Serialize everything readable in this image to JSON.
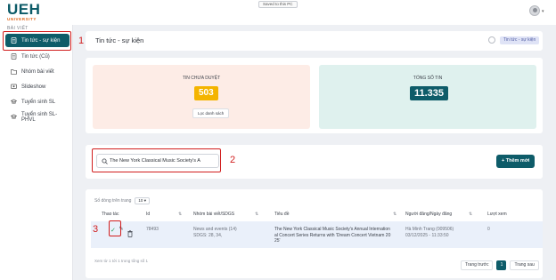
{
  "header": {
    "logo_main": "UEH",
    "logo_sub": "UNIVERSITY",
    "saved_label": "Saved to this PC"
  },
  "sidebar": {
    "section": "BÀI VIẾT",
    "items": [
      {
        "label": "Tin tức - sự kiện",
        "icon": "document-icon",
        "active": true
      },
      {
        "label": "Tin tức (Cũ)",
        "icon": "document-icon"
      },
      {
        "label": "Nhóm bài viết",
        "icon": "folder-icon"
      },
      {
        "label": "Slideshow",
        "icon": "slides-icon"
      },
      {
        "label": "Tuyển sinh SL",
        "icon": "cap-icon"
      },
      {
        "label": "Tuyển sinh SL-PHVL",
        "icon": "cap-icon"
      }
    ]
  },
  "page": {
    "title": "Tin tức - sự kiện",
    "chip": "Tin tức - sự kiện"
  },
  "stats": {
    "pending_label": "TIN CHƯA DUYỆT",
    "pending_value": "503",
    "filter_label": "Lọc danh sách",
    "total_label": "TỔNG SỐ TIN",
    "total_value": "11.335"
  },
  "search": {
    "value": "The New York Classical Music Society's A"
  },
  "add_button": "+ Thêm mới",
  "table": {
    "page_size_label": "Số dòng trên trang",
    "page_size_value": "10",
    "columns": [
      "Thao tác",
      "Id",
      "Nhóm bài viết/SDGS",
      "Tiêu đề",
      "Người đăng/Ngày đăng",
      "Lượt xem"
    ],
    "row": {
      "id": "78493",
      "group_line1": "News and events (14)",
      "group_line2": "SDGS: 28, 34,",
      "title_line1": "The New York Classical Music Society's Annual Internation",
      "title_line2": "al Concert Series Returns with 'Dream Concert Vietnam 20",
      "title_line3": "25'",
      "poster_line1": "Hà Minh Trang (009506)",
      "poster_line2": "03/12/2025 - 11:33:50",
      "views": "0"
    },
    "footer": "Xem từ 1 tới 1 trong tổng số 1",
    "prev": "Trang trước",
    "current_page": "1",
    "next": "Trang sau"
  },
  "annotations": [
    "1",
    "2",
    "3"
  ],
  "colors": {
    "primary": "#0e5c69",
    "pending": "#f4b400",
    "annotation": "#d11d1d"
  }
}
